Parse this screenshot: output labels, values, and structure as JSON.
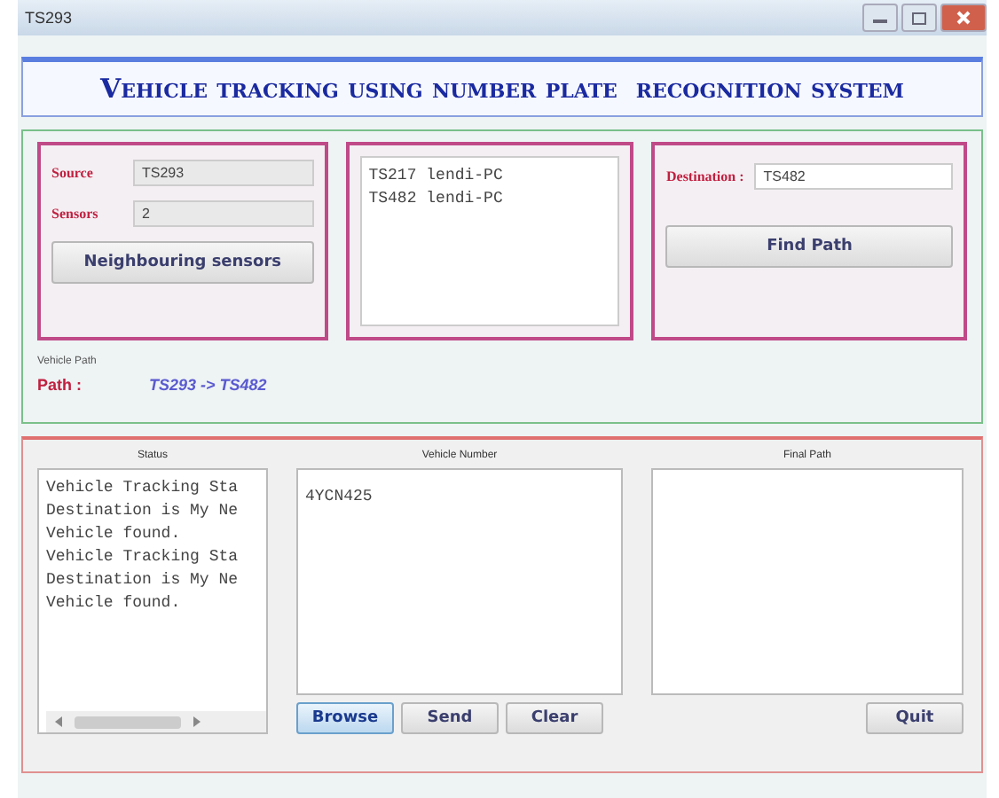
{
  "window": {
    "title": "TS293"
  },
  "banner": {
    "title": "Vehicle tracking using number plate  recognition system"
  },
  "source_panel": {
    "fields": [
      {
        "label": "Source",
        "value": "TS293"
      },
      {
        "label": "Sensors",
        "value": "2"
      }
    ],
    "button": "Neighbouring sensors"
  },
  "neighbours": [
    "TS217 lendi-PC",
    "TS482 lendi-PC"
  ],
  "destination_panel": {
    "label": "Destination :",
    "value": "TS482",
    "button": "Find Path"
  },
  "vehicle_path": {
    "caption": "Vehicle Path",
    "label": "Path :",
    "value": "TS293 -> TS482"
  },
  "status": {
    "heading": "Status",
    "lines": [
      "Vehicle Tracking Sta",
      "Destination is My Ne",
      "Vehicle found.",
      "Vehicle Tracking Sta",
      "Destination is My Ne",
      "Vehicle found."
    ]
  },
  "vehicle_number": {
    "heading": "Vehicle Number",
    "value": "4YCN425",
    "buttons": [
      {
        "label": "Browse",
        "focused": true
      },
      {
        "label": "Send",
        "focused": false
      },
      {
        "label": "Clear",
        "focused": false
      }
    ]
  },
  "final_path": {
    "heading": "Final Path",
    "button": "Quit"
  }
}
